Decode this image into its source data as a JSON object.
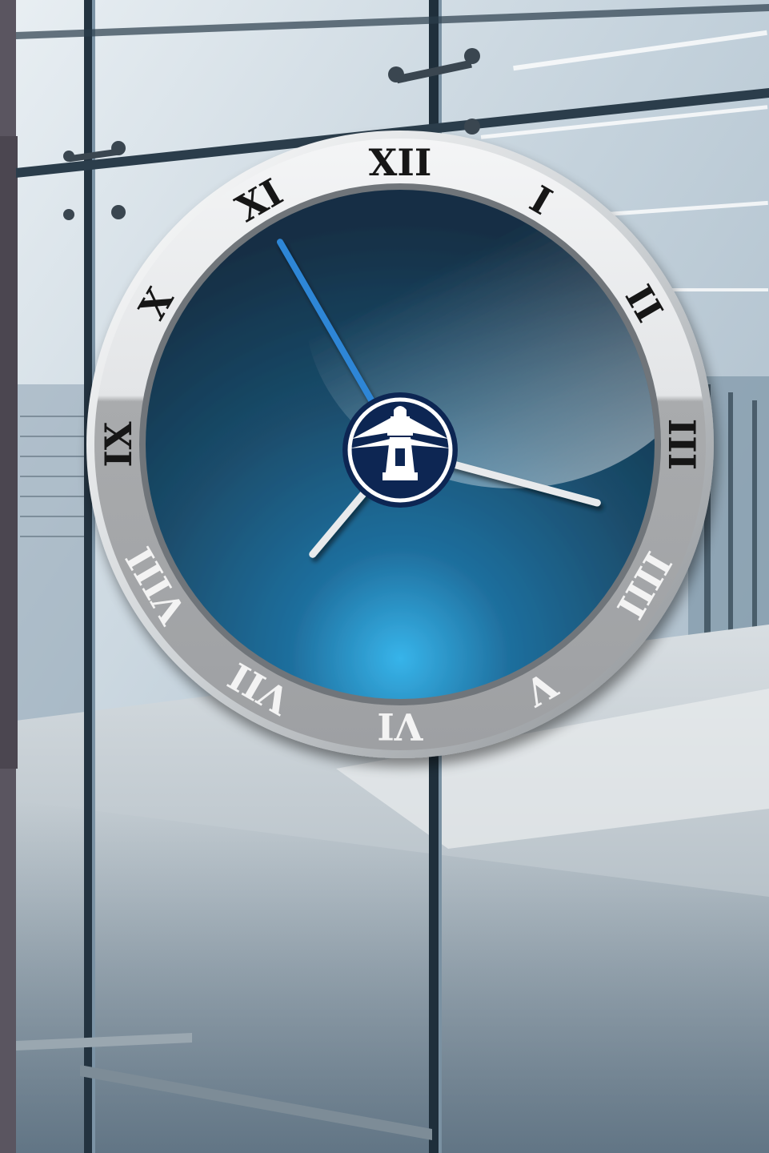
{
  "scene": {
    "description_free": true,
    "colors": {
      "frame_left": "#5a5560",
      "glass_light": "#dfe8ee",
      "glass_mid": "#a9bccb",
      "floor": "#c9d1d6",
      "mullion": "#233340",
      "dial_dark": "#15384f",
      "dial_light": "#2aa3dc",
      "bezel_white": "#eceeef",
      "bezel_grey": "#a7a9ab",
      "numeral_dark": "#151515",
      "numeral_light": "#f3f3f3",
      "minute_hand": "#2f86d6",
      "hand_silver": "#e8eaec",
      "logo_navy": "#0f2653"
    }
  },
  "clock": {
    "numerals": [
      "XII",
      "I",
      "II",
      "III",
      "IIII",
      "V",
      "VI",
      "VII",
      "VIII",
      "IX",
      "X",
      "XI"
    ],
    "time": {
      "hour_hand_angle_deg": 220,
      "minute_hand_angle_deg": 330,
      "second_hand_angle_deg": 105
    },
    "logo_icon": "lighthouse-icon"
  }
}
